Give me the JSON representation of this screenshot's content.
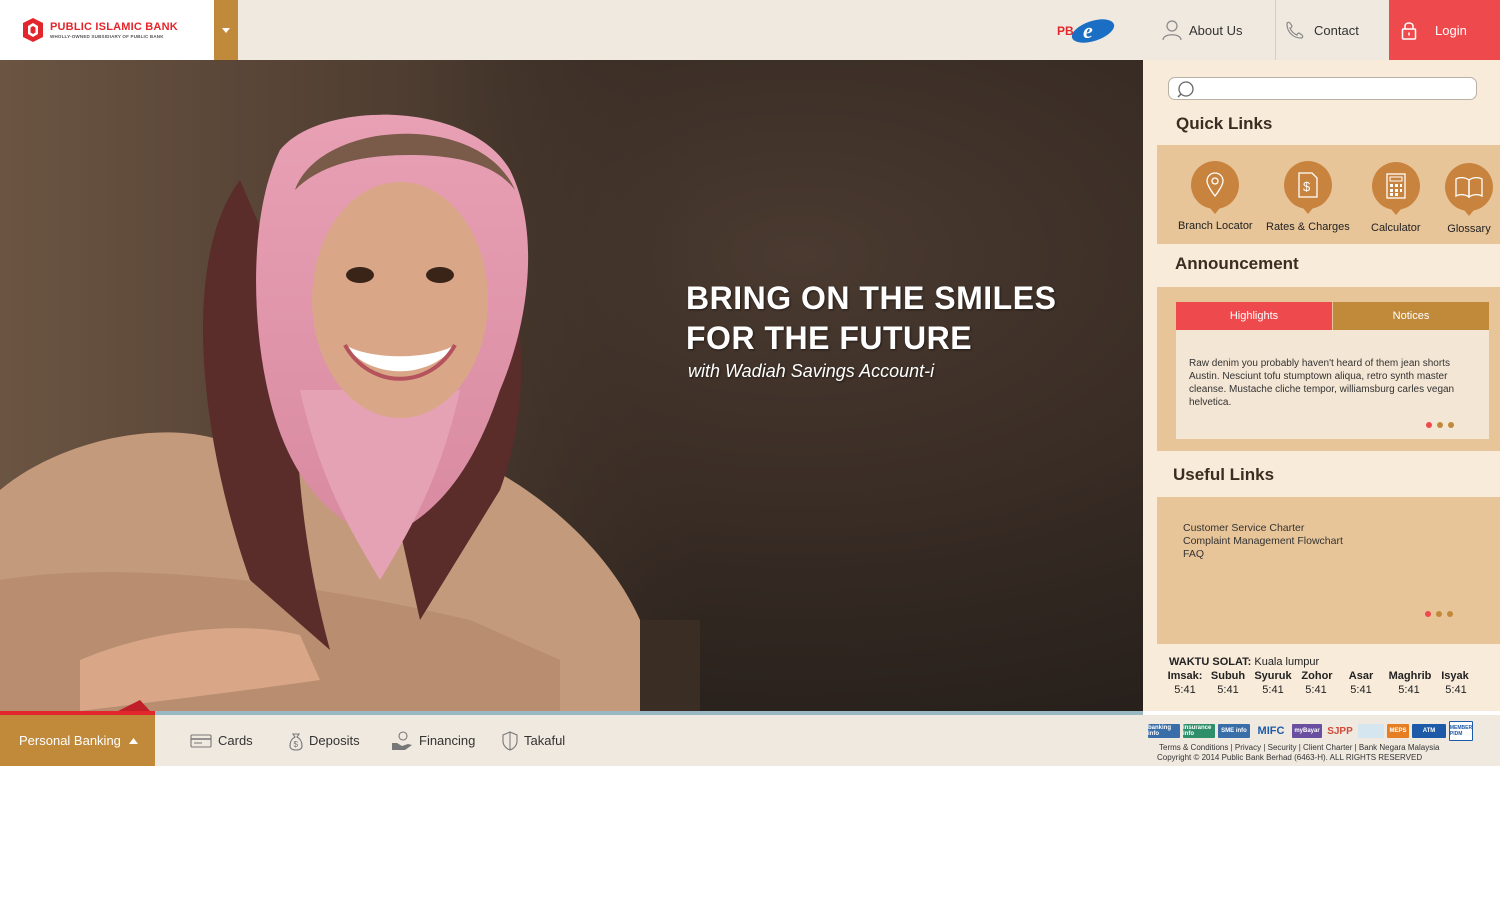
{
  "header": {
    "logo_name": "PUBLIC ISLAMIC BANK",
    "logo_sub": "WHOLLY-OWNED SUBSIDIARY OF PUBLIC BANK",
    "pbe_logo": "PB e",
    "nav": {
      "about": "About Us",
      "contact": "Contact",
      "login": "Login"
    }
  },
  "hero": {
    "title_line1": "BRING ON THE SMILES",
    "title_line2": "FOR THE FUTURE",
    "subtitle": "with Wadiah Savings Account-i"
  },
  "sidebar": {
    "search_placeholder": "",
    "quick_links_title": "Quick Links",
    "quick_links": [
      {
        "label": "Branch Locator",
        "icon": "location-pin-icon"
      },
      {
        "label": "Rates & Charges",
        "icon": "dollar-document-icon"
      },
      {
        "label": "Calculator",
        "icon": "calculator-icon"
      },
      {
        "label": "Glossary",
        "icon": "book-icon"
      }
    ],
    "announcement_title": "Announcement",
    "announcement_tabs": {
      "highlights": "Highlights",
      "notices": "Notices"
    },
    "announcement_text": "Raw denim you probably haven't heard of them jean shorts Austin. Nesciunt tofu stumptown aliqua, retro synth master cleanse. Mustache cliche tempor, williamsburg carles vegan helvetica.",
    "useful_links_title": "Useful Links",
    "useful_links": [
      "Customer Service Charter",
      "Complaint Management Flowchart",
      "FAQ"
    ],
    "prayer": {
      "title": "WAKTU SOLAT:",
      "location": "Kuala lumpur",
      "names": [
        "Imsak:",
        "Subuh",
        "Syuruk",
        "Zohor",
        "Asar",
        "Maghrib",
        "Isyak"
      ],
      "times": [
        "5:41",
        "5:41",
        "5:41",
        "5:41",
        "5:41",
        "5:41",
        "5:41"
      ]
    }
  },
  "bottom_nav": {
    "personal_banking": "Personal Banking",
    "items": [
      "Cards",
      "Deposits",
      "Financing",
      "Takaful"
    ]
  },
  "footer": {
    "partners": [
      "banking info",
      "insurance info",
      "SME info",
      "MIFC",
      "myBayar",
      "SJPP",
      "",
      "MEPS",
      "ATM",
      "MEMBER PIDM"
    ],
    "links": "Terms & Conditions | Privacy | Security | Client Charter | Bank Negara Malaysia",
    "copyright": "Copyright © 2014 Public Bank Berhad (6463-H). ALL RIGHTS RESERVED"
  },
  "colors": {
    "brand_red": "#e3262b",
    "login_red": "#ee4a4d",
    "gold": "#c18a3b",
    "tan": "#e8c598",
    "sidebar_bg": "#f8ebda"
  }
}
